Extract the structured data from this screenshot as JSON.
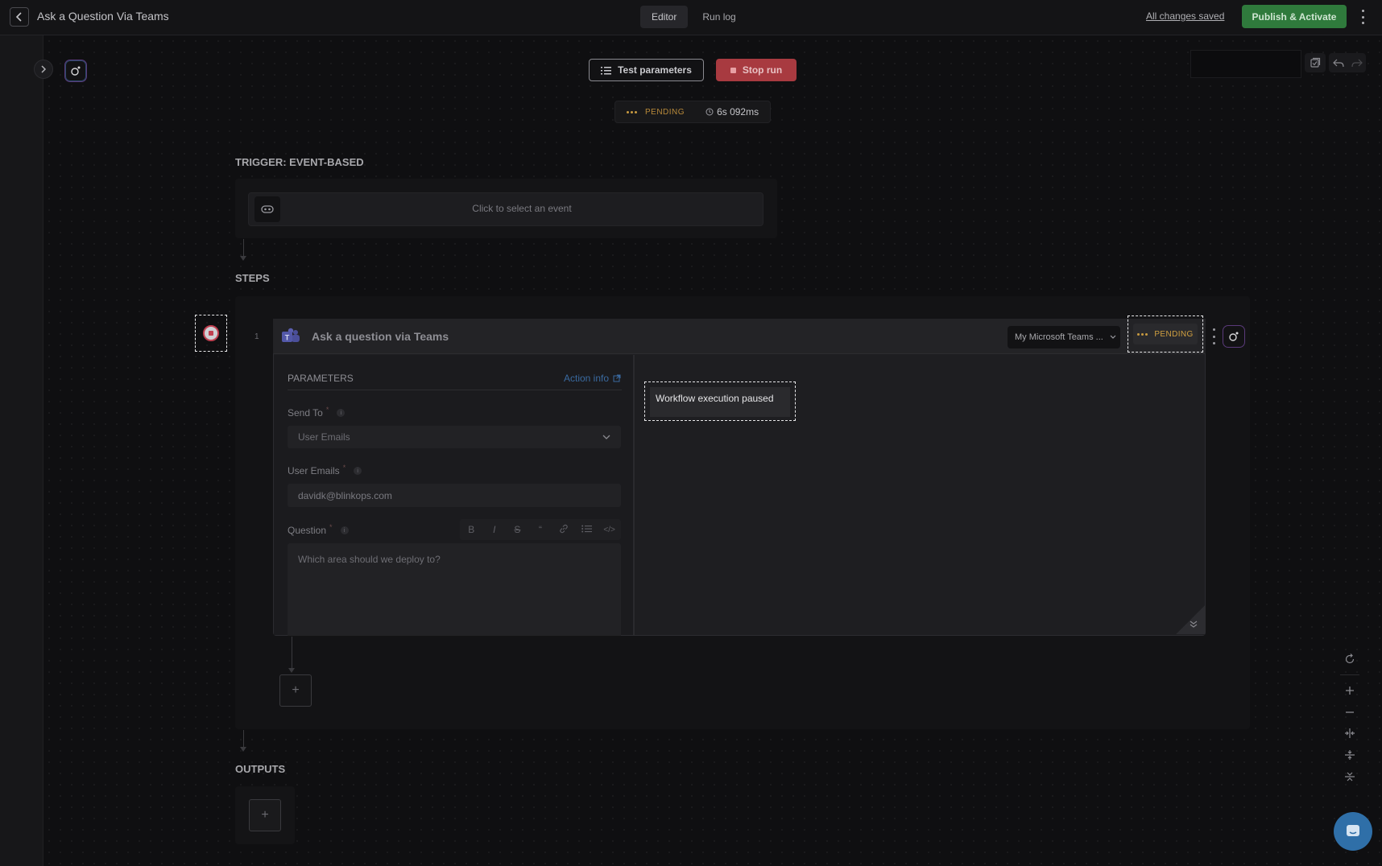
{
  "header": {
    "title": "Ask a Question Via Teams",
    "tabs": [
      {
        "label": "Editor",
        "active": true
      },
      {
        "label": "Run log",
        "active": false
      }
    ],
    "saved_status": "All changes saved",
    "publish_label": "Publish & Activate"
  },
  "toolbar": {
    "test_params_label": "Test parameters",
    "stop_run_label": "Stop run"
  },
  "run_status": {
    "state": "PENDING",
    "duration": "6s 092ms"
  },
  "trigger": {
    "section_label": "TRIGGER: EVENT-BASED",
    "placeholder": "Click to select an event"
  },
  "steps": {
    "section_label": "STEPS",
    "items": [
      {
        "number": "1",
        "title": "Ask a question via Teams",
        "account": "My Microsoft Teams ...",
        "status": "PENDING",
        "parameters": {
          "title": "PARAMETERS",
          "action_info": "Action info",
          "send_to": {
            "label": "Send To",
            "required_mark": "*",
            "value": "User Emails"
          },
          "user_emails": {
            "label": "User Emails",
            "required_mark": "*",
            "value": "davidk@blinkops.com"
          },
          "question": {
            "label": "Question",
            "required_mark": "*",
            "value": "Which area should we deploy to?"
          }
        },
        "output_note": "Workflow execution paused"
      }
    ],
    "add_label": "+"
  },
  "outputs": {
    "section_label": "OUTPUTS",
    "add_label": "+"
  },
  "editor_toolbar": [
    "B",
    "I",
    "S",
    "“",
    "link",
    "list",
    "</>"
  ],
  "colors": {
    "accent_green": "#2f7a3c",
    "stop_red": "#a83a40",
    "pending_amber": "#d0a040",
    "link_blue": "#3a6aa0"
  },
  "icons": [
    "back-icon",
    "chevron-right-icon",
    "bot-icon",
    "list-icon",
    "stop-icon",
    "clock-icon",
    "event-icon",
    "teams-icon",
    "chevron-down-icon",
    "external-link-icon",
    "info-icon",
    "refresh-icon",
    "zoom-in-icon",
    "zoom-out-icon",
    "fit-width-icon",
    "fit-height-icon",
    "collapse-icon",
    "chat-icon"
  ]
}
